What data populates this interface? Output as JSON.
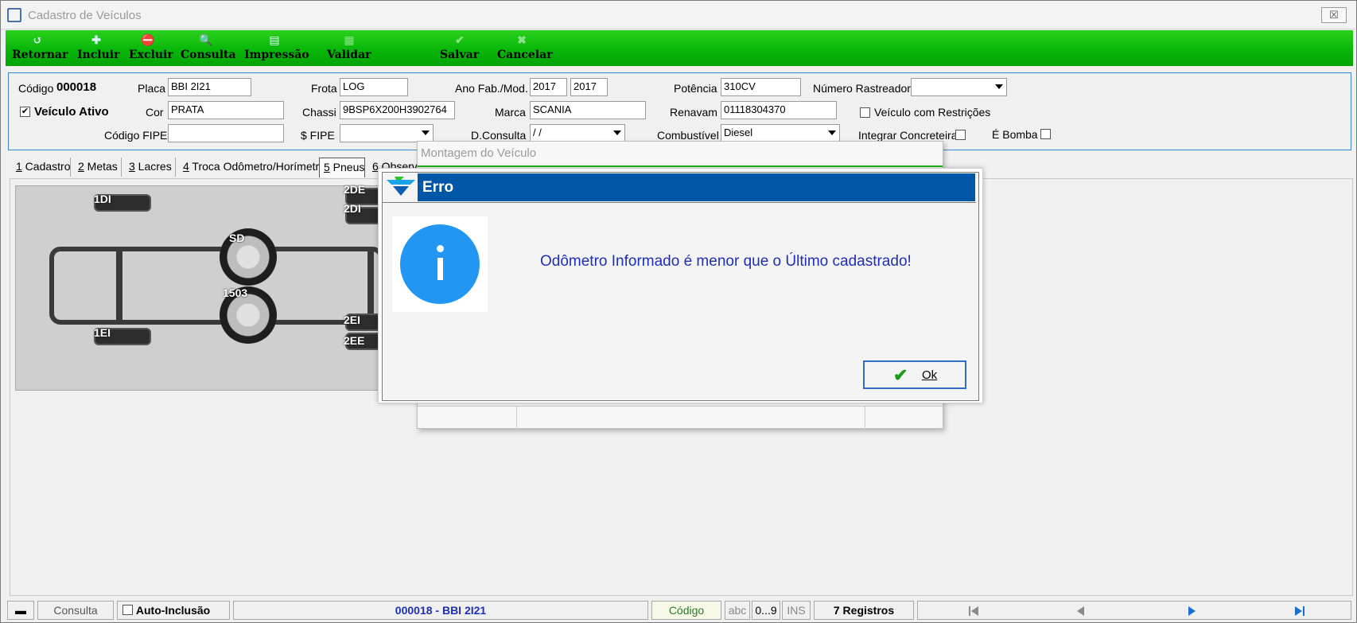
{
  "window": {
    "title": "Cadastro de Veículos",
    "close_label": "☒"
  },
  "toolbar": {
    "buttons": [
      {
        "label": "Retornar",
        "icon": "return-icon"
      },
      {
        "label": "Incluir",
        "icon": "add-icon"
      },
      {
        "label": "Excluir",
        "icon": "delete-icon"
      },
      {
        "label": "Consulta",
        "icon": "search-icon"
      },
      {
        "label": "Impressão",
        "icon": "printer-icon"
      },
      {
        "label": "Validar",
        "icon": "validate-icon"
      },
      {
        "label": "Salvar",
        "icon": "save-check-icon"
      },
      {
        "label": "Cancelar",
        "icon": "cancel-x-icon"
      }
    ]
  },
  "form": {
    "codigo_label": "Código",
    "codigo_value": "000018",
    "placa_label": "Placa",
    "placa_value": "BBI 2I21",
    "frota_label": "Frota",
    "frota_value": "LOG",
    "ano_label": "Ano Fab./Mod.",
    "ano_fab_value": "2017",
    "ano_mod_value": "2017",
    "potencia_label": "Potência",
    "potencia_value": "310CV",
    "rastreador_label": "Número Rastreador",
    "rastreador_value": "",
    "ativo_label": "Veículo Ativo",
    "ativo_checked": "✔",
    "cor_label": "Cor",
    "cor_value": "PRATA",
    "chassi_label": "Chassi",
    "chassi_value": "9BSP6X200H3902764",
    "marca_label": "Marca",
    "marca_value": "SCANIA",
    "renavam_label": "Renavam",
    "renavam_value": "01118304370",
    "restricoes_label": "Veículo com Restrições",
    "fipe_label": "Código FIPE",
    "fipe_value": "",
    "sfipe_label": "$ FIPE",
    "sfipe_value": "",
    "dconsulta_label": "D.Consulta",
    "dconsulta_value": " /  / ",
    "combustivel_label": "Combustível",
    "combustivel_value": "Diesel",
    "concreteira_label": "Integrar Concreteira",
    "bomba_label": "É Bomba"
  },
  "tabs": [
    {
      "num": "1",
      "label": " Cadastro"
    },
    {
      "num": "2",
      "label": " Metas"
    },
    {
      "num": "3",
      "label": " Lacres"
    },
    {
      "num": "4",
      "label": " Troca Odômetro/Horímetro"
    },
    {
      "num": "5",
      "label": " Pneus"
    },
    {
      "num": "6",
      "label": " Observ"
    }
  ],
  "vehicle": {
    "tires": {
      "t1di": "1DI",
      "t1ei": "1EI",
      "t2de": "2DE",
      "t2di": "2DI",
      "t2ei": "2EI",
      "t2ee": "2EE",
      "tsd": "SD",
      "t1503": "1503"
    }
  },
  "back_window": {
    "title": "Montagem do Veículo"
  },
  "dialog": {
    "title": "Erro",
    "message": "Odômetro Informado é menor que o Último cadastrado!",
    "ok_label": "Ok"
  },
  "status": {
    "mode": "Consulta",
    "auto_inclusao": "Auto-Inclusão",
    "record": "000018 - BBI 2I21",
    "sort": "Código",
    "abc": "abc",
    "num": "0...9",
    "ins": "INS",
    "registros": "7 Registros"
  }
}
